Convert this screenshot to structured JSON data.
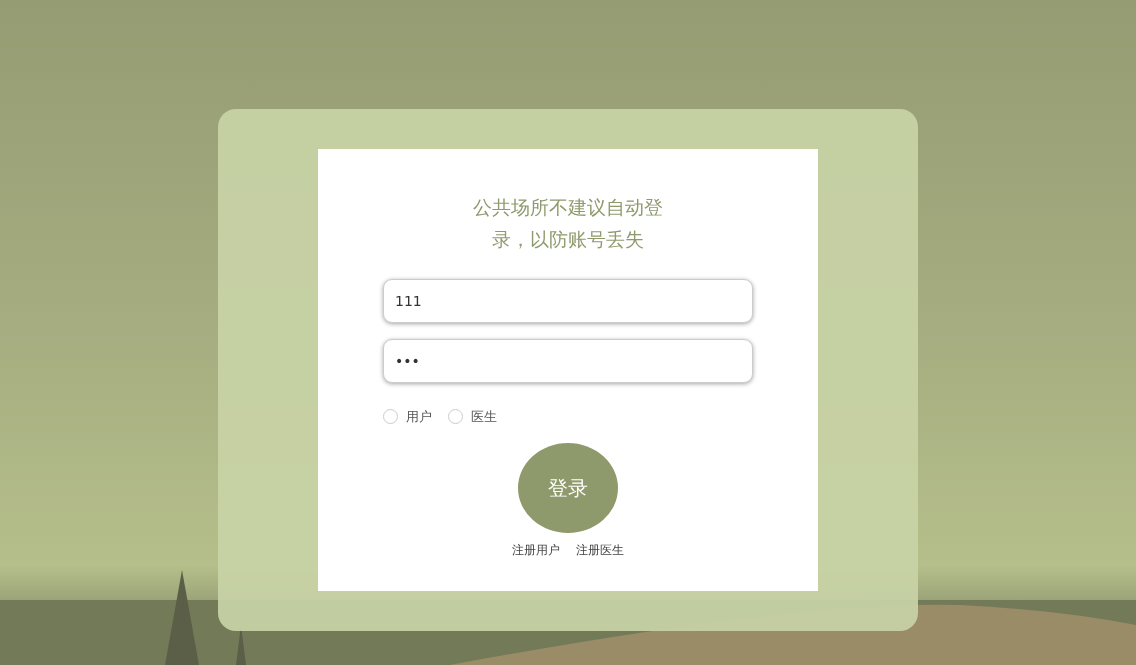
{
  "notice": "公共场所不建议自动登录，以防账号丢失",
  "username": {
    "value": "111"
  },
  "password": {
    "value": "•••"
  },
  "roles": [
    {
      "label": "用户",
      "selected": false
    },
    {
      "label": "医生",
      "selected": false
    }
  ],
  "login_button": "登录",
  "links": [
    "注册用户",
    "注册医生"
  ]
}
